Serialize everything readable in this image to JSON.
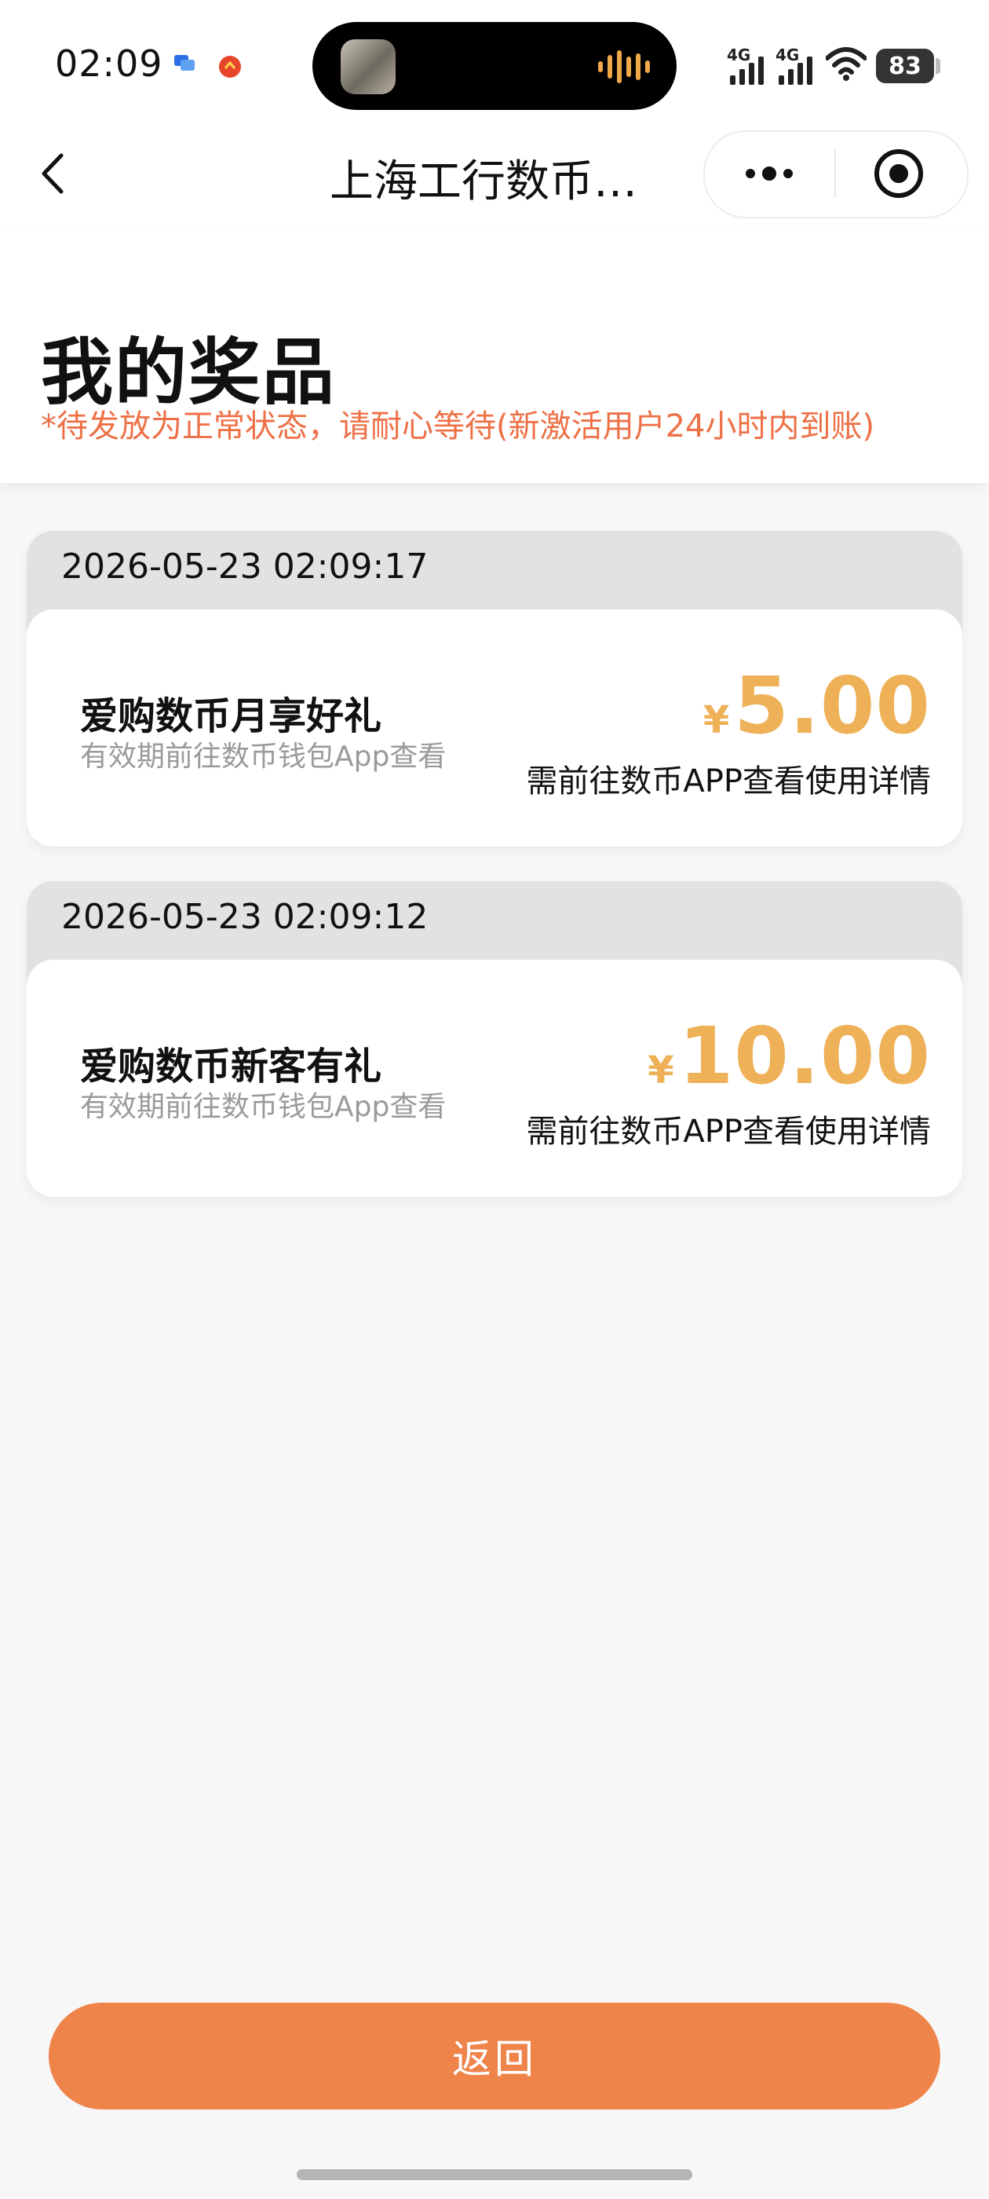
{
  "status_bar": {
    "time": "02:09",
    "signal_1": "4G",
    "signal_2": "4G",
    "battery": "83"
  },
  "navbar": {
    "title": "上海工行数币…"
  },
  "header": {
    "title": "我的奖品",
    "notice": "*待发放为正常状态，请耐心等待(新激活用户24小时内到账)"
  },
  "prizes": [
    {
      "date": "2026-05-23 02:09:17",
      "name": "爱购数币月享好礼",
      "validity": "有效期前往数币钱包App查看",
      "currency": "¥",
      "amount": "5.00",
      "note": "需前往数币APP查看使用详情"
    },
    {
      "date": "2026-05-23 02:09:12",
      "name": "爱购数币新客有礼",
      "validity": "有效期前往数币钱包App查看",
      "currency": "¥",
      "amount": "10.00",
      "note": "需前往数币APP查看使用详情"
    }
  ],
  "footer": {
    "return_label": "返回"
  },
  "colors": {
    "accent": "#ef844b",
    "notice": "#ee7046",
    "amount": "#eeb157"
  }
}
